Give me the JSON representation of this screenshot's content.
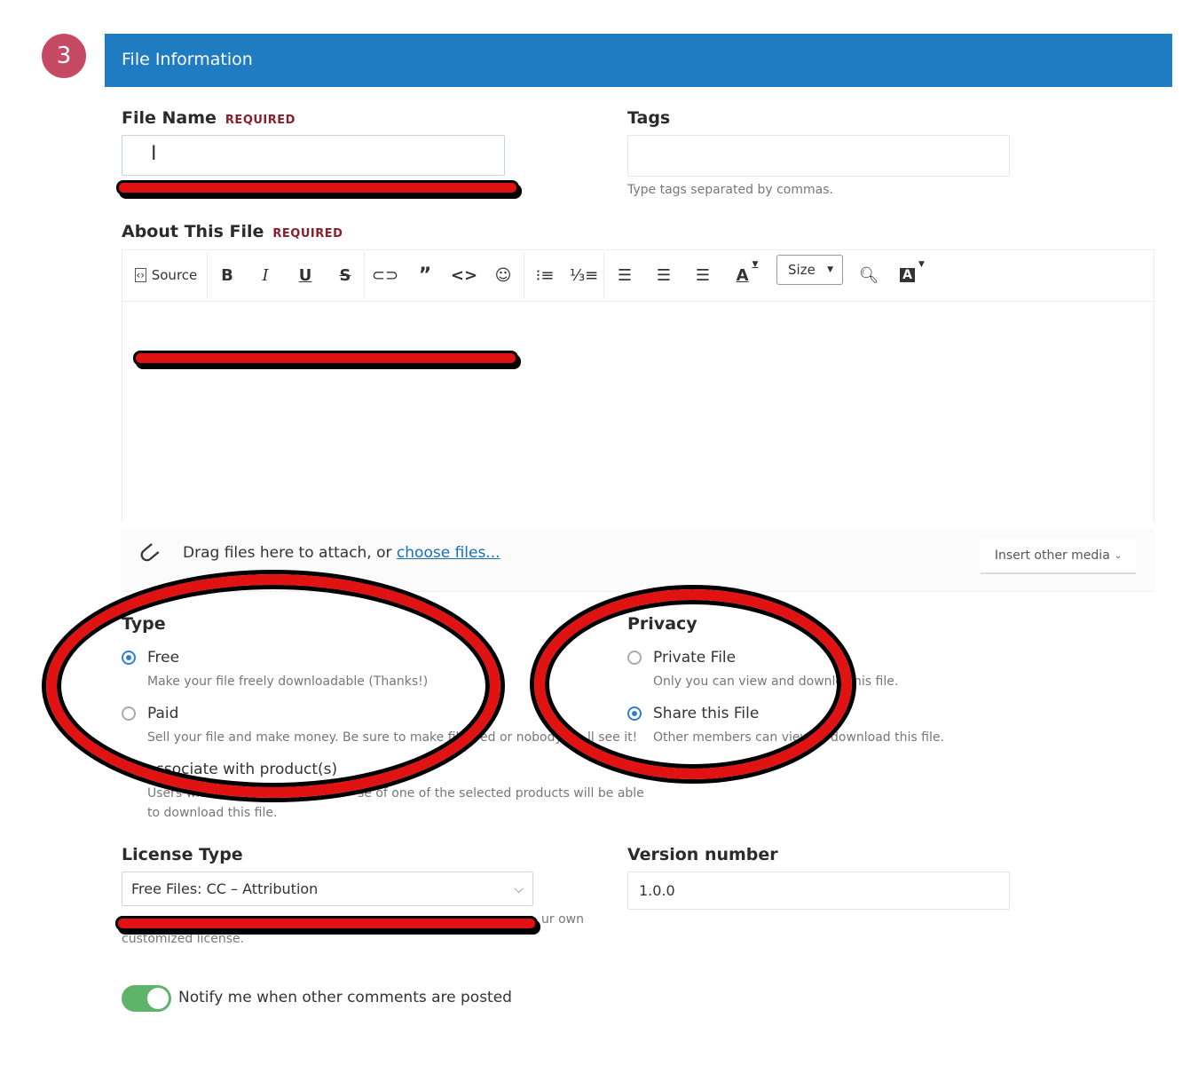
{
  "step": {
    "number": "3"
  },
  "header": {
    "title": "File Information"
  },
  "file_name": {
    "label": "File Name",
    "required": "REQUIRED",
    "value": ""
  },
  "tags": {
    "label": "Tags",
    "value": "",
    "hint": "Type tags separated by commas."
  },
  "about": {
    "label": "About This File",
    "required": "REQUIRED"
  },
  "editor": {
    "source_label": "Source",
    "size_label": "Size",
    "icons": [
      "source-icon",
      "bold-icon",
      "italic-icon",
      "underline-icon",
      "strikethrough-icon",
      "link-icon",
      "quote-icon",
      "code-icon",
      "emoji-icon",
      "bulleted-list-icon",
      "numbered-list-icon",
      "align-left-icon",
      "align-center-icon",
      "align-right-icon",
      "text-color-icon",
      "preview-icon",
      "font-icon"
    ]
  },
  "attach": {
    "text": "Drag files here to attach, or",
    "link": "choose files...",
    "insert_media": "Insert other media"
  },
  "type": {
    "label": "Type",
    "options": [
      {
        "label": "Free",
        "desc": "Make your file freely downloadable (Thanks!)",
        "selected": true
      },
      {
        "label": "Paid",
        "desc": "Sell your file and make money. Be sure to make file",
        "desc2": "ed or nobody",
        "desc3": "ll see it!",
        "selected": false
      },
      {
        "label": "ssociate with product(s)",
        "desc": "Users who",
        "desc2": "se of one of the selected products will be able",
        "desc3": "to download this file."
      }
    ]
  },
  "privacy": {
    "label": "Privacy",
    "options": [
      {
        "label": "Private File",
        "desc": "Only you can view and downloa",
        "desc2": "his file.",
        "selected": false
      },
      {
        "label": "Share this File",
        "desc": "Other members can view",
        "desc2": "download this file.",
        "selected": true
      }
    ]
  },
  "license": {
    "label": "License Type",
    "value": "Free Files: CC – Attribution",
    "hint_tail": "ur own",
    "hint_line2": "customized license."
  },
  "version": {
    "label": "Version number",
    "value": "1.0.0"
  },
  "notify": {
    "label": "Notify me when other comments are posted",
    "enabled": true
  },
  "colors": {
    "accent": "#1f7cc0",
    "step": "#c74a65",
    "toggle": "#5fb36a",
    "required": "#8b1d2c",
    "link": "#1a6db8"
  }
}
